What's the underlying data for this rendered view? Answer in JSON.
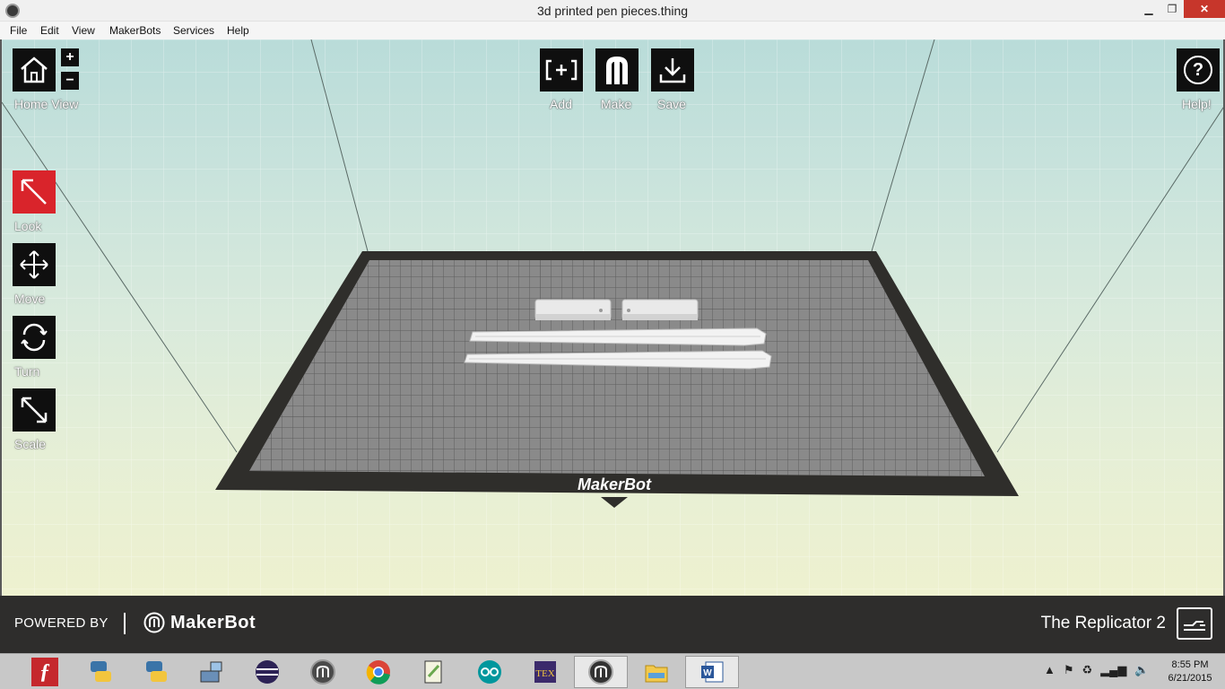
{
  "window": {
    "title": "3d printed pen pieces.thing",
    "min_glyph": "▁",
    "max_glyph": "❐",
    "close_glyph": "✕"
  },
  "menu": [
    "File",
    "Edit",
    "View",
    "MakerBots",
    "Services",
    "Help"
  ],
  "toolbar": {
    "home_label": "Home View",
    "zoom_in": "+",
    "zoom_out": "−",
    "add_label": "Add",
    "make_label": "Make",
    "save_label": "Save",
    "help_label": "Help!",
    "help_glyph": "?"
  },
  "tools": {
    "look_label": "Look",
    "move_label": "Move",
    "turn_label": "Turn",
    "scale_label": "Scale"
  },
  "build_plate": {
    "brand": "MakerBot",
    "objects": [
      "pen-clip-part",
      "pen-clip-part",
      "pen-barrel-half",
      "pen-barrel-half"
    ]
  },
  "footer": {
    "powered_by": "POWERED BY",
    "brand_name": "MakerBot",
    "printer_name": "The Replicator 2"
  },
  "taskbar": {
    "apps": [
      "fusion-icon",
      "python-icon",
      "python-icon",
      "network-setup-icon",
      "eclipse-icon",
      "makerware-icon",
      "chrome-icon",
      "notepad-plus-icon",
      "arduino-icon",
      "tex-icon",
      "makerbot-icon",
      "file-explorer-icon",
      "word-icon"
    ],
    "active_index": 10,
    "time": "8:55 PM",
    "date": "6/21/2015"
  },
  "colors": {
    "look_tool": "#d9242b",
    "tool": "#0f0f0f",
    "footer": "#2e2d2c",
    "close_button": "#c7362b"
  }
}
